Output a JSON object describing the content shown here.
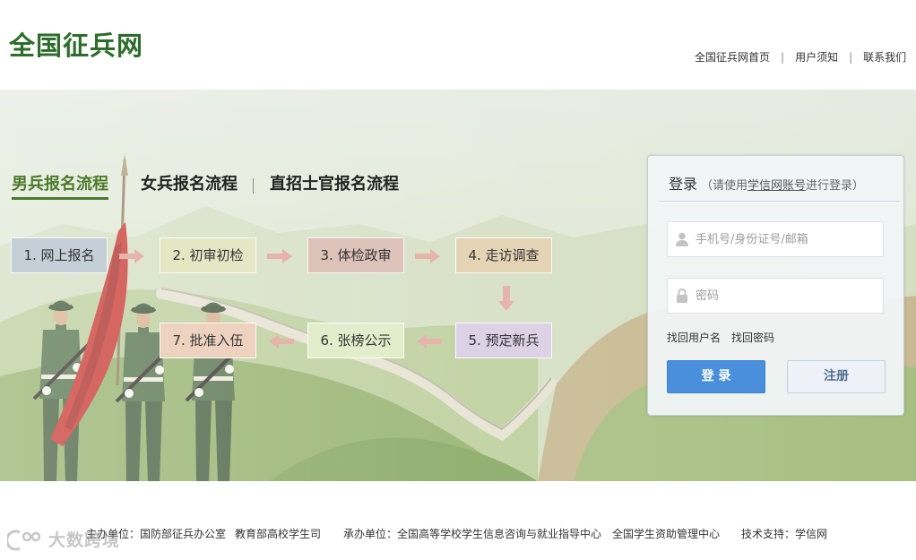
{
  "header": {
    "logo": "全国征兵网",
    "separator": "|",
    "nav": [
      {
        "label": "全国征兵网首页"
      },
      {
        "label": "用户须知"
      },
      {
        "label": "联系我们"
      }
    ]
  },
  "process": {
    "tabs": [
      {
        "label": "男兵报名流程",
        "active": true
      },
      {
        "label": "女兵报名流程",
        "active": false
      },
      {
        "label": "直招士官报名流程",
        "active": false
      }
    ],
    "steps": [
      {
        "label": "1. 网上报名",
        "color": "#c4cfd7"
      },
      {
        "label": "2. 初审初检",
        "color": "#e3e7c4"
      },
      {
        "label": "3. 体检政审",
        "color": "#dcc2b8"
      },
      {
        "label": "4. 走访调查",
        "color": "#e4d3b4"
      },
      {
        "label": "5. 预定新兵",
        "color": "#ddd1e6"
      },
      {
        "label": "6. 张榜公示",
        "color": "#e2edcb"
      },
      {
        "label": "7. 批准入伍",
        "color": "#eed2c0"
      }
    ],
    "arrow_color": "#e6b4ab"
  },
  "login": {
    "title": "登录",
    "hint_open": "（请使用",
    "hint_link": "学信网账号",
    "hint_close": "进行登录）",
    "username": {
      "placeholder": "手机号/身份证号/邮箱",
      "icon": "user-icon"
    },
    "password": {
      "placeholder": "密码",
      "icon": "lock-icon"
    },
    "find_username": "找回用户名",
    "find_password": "找回密码",
    "login_button": "登 录",
    "register_button": "注册"
  },
  "footer": {
    "items": [
      "主办单位：国防部征兵办公室",
      "教育部高校学生司",
      "承办单位：全国高等学校学生信息咨询与就业指导中心",
      "全国学生资助管理中心",
      "技术支持：学信网"
    ]
  },
  "watermark": "大数跨境",
  "colors": {
    "brand_green": "#2c6d2b",
    "active_tab": "#4c7a2c",
    "login_button": "#4a8fdc",
    "flag_red": "#c62f28"
  }
}
